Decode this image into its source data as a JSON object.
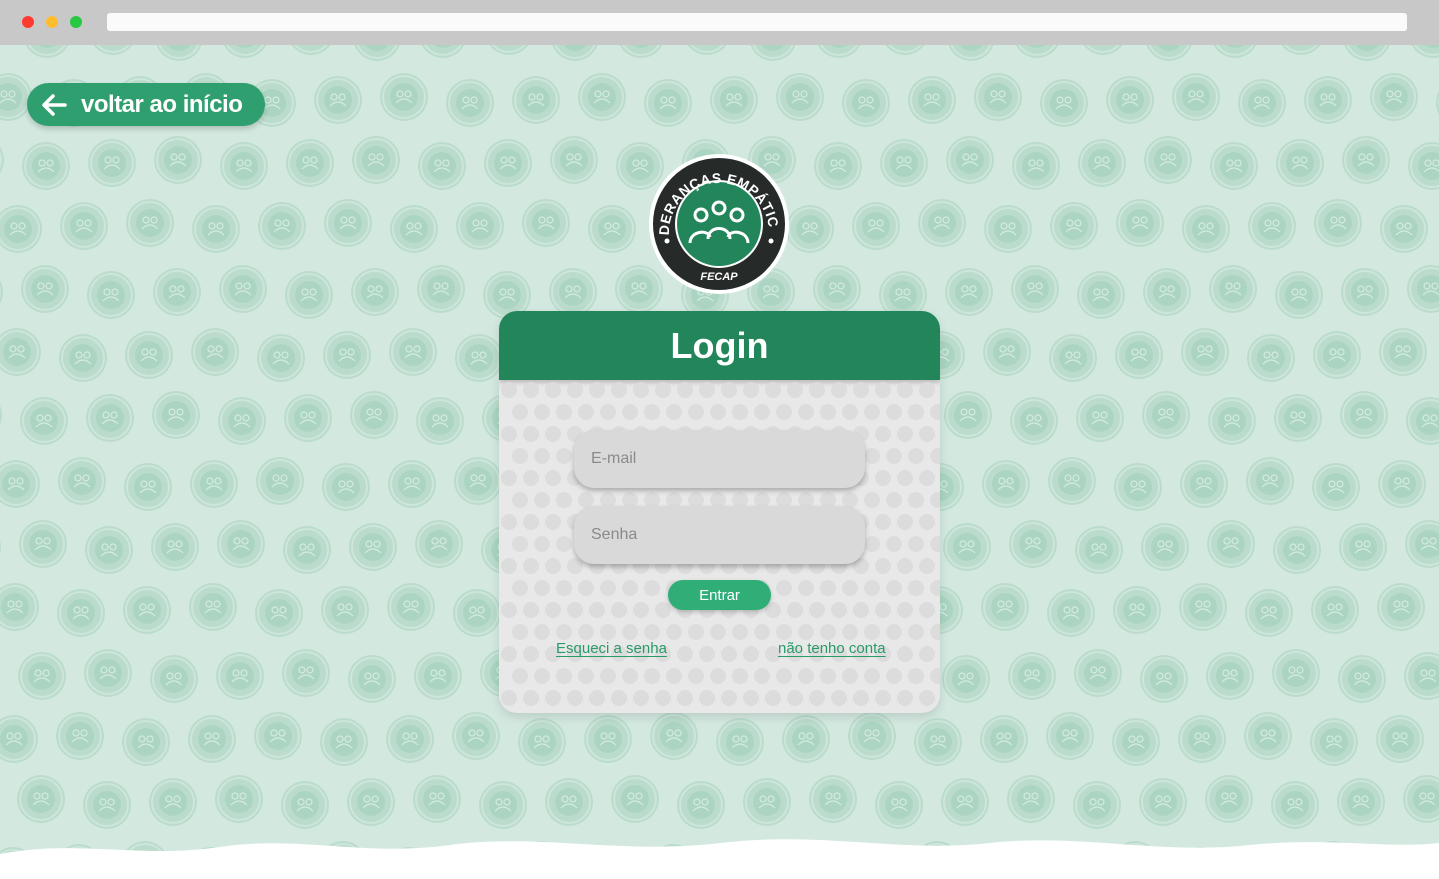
{
  "back_button": {
    "label": "voltar ao início"
  },
  "logo": {
    "ring_text": "LIDERANÇAS EMPÁTICAS",
    "brand": "FECAP"
  },
  "login": {
    "title": "Login",
    "email_placeholder": "E-mail",
    "password_placeholder": "Senha",
    "submit_label": "Entrar",
    "forgot_link": "Esqueci a senha",
    "signup_link": "não tenho conta"
  },
  "colors": {
    "primary_green": "#23865b",
    "button_green": "#2fae78",
    "background_mint": "#d3e9e0"
  }
}
